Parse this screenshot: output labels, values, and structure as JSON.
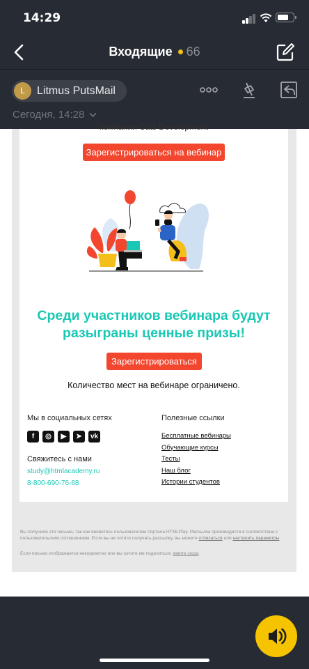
{
  "status_bar": {
    "time": "14:29"
  },
  "nav": {
    "title": "Входящие",
    "unread_count": "66"
  },
  "header": {
    "sender_initial": "L",
    "sender_name": "Litmus PutsMail",
    "date": "Сегодня, 14:28"
  },
  "email": {
    "cut_text": "компании Cats Development",
    "register_webinar_button": "Зарегистрироваться на вебинар",
    "headline_line1": "Среди участников вебинара будут",
    "headline_line2": "разыграны ценные призы!",
    "register_button": "Зарегистрироваться",
    "limited_text": "Количество мест на вебинаре ограничено.",
    "social_title": "Мы в социальных сетях",
    "social_icons": [
      {
        "name": "facebook-icon",
        "glyph": "f"
      },
      {
        "name": "instagram-icon",
        "glyph": "◎"
      },
      {
        "name": "youtube-icon",
        "glyph": "▶"
      },
      {
        "name": "telegram-icon",
        "glyph": "➤"
      },
      {
        "name": "vk-icon",
        "glyph": "vk"
      }
    ],
    "contact_title": "Свяжитесь с нами",
    "contact_email": "study@htmlacademy.ru",
    "contact_phone": "8-800-690-76-68",
    "links_title": "Полезные ссылки",
    "links": [
      "Бесплатные вебинары",
      "Обучающие курсы",
      "Тесты",
      "Наш блог",
      "Истории студентов"
    ],
    "disclaimer_text_1": "Вы получили это письмо, так как являетесь пользователем портала HTMLPlay. Рассылка производится в соответствии с пользовательским соглашением. Если вы не хотите получать рассылку, вы можете ",
    "disclaimer_link_unsubscribe": "отписаться",
    "disclaimer_or": " или ",
    "disclaimer_link_settings": "настроить параметры",
    "disclaimer_end": ".",
    "view_online_text": "Если письмо отображается некорректно или вы хотите им поделиться, ",
    "view_online_link": "жмите сюда",
    "view_online_end": "."
  },
  "colors": {
    "accent_teal": "#19c8b4",
    "button_red": "#f2462f",
    "audio_yellow": "#f6c300",
    "chrome_dark": "#272b33"
  }
}
